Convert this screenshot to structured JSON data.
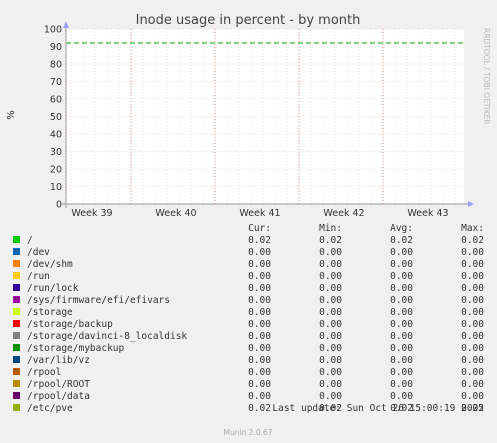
{
  "chart_data": {
    "type": "line",
    "title": "Inode usage in percent - by month",
    "ylabel": "%",
    "side_label": "RRDTOOL / TOBI OETIKER",
    "ylim": [
      0,
      100
    ],
    "yticks": [
      0,
      10,
      20,
      30,
      40,
      50,
      60,
      70,
      80,
      90,
      100
    ],
    "xtick_labels": [
      "Week 39",
      "Week 40",
      "Week 41",
      "Week 42",
      "Week 43"
    ],
    "warning_level": 92,
    "grid": true,
    "columns": [
      "Cur:",
      "Min:",
      "Avg:",
      "Max:"
    ],
    "series": [
      {
        "name": "/",
        "color": "#00cc00",
        "cur": "0.02",
        "min": "0.02",
        "avg": "0.02",
        "max": "0.02"
      },
      {
        "name": "/dev",
        "color": "#0066b3",
        "cur": "0.00",
        "min": "0.00",
        "avg": "0.00",
        "max": "0.00"
      },
      {
        "name": "/dev/shm",
        "color": "#ff8000",
        "cur": "0.00",
        "min": "0.00",
        "avg": "0.00",
        "max": "0.00"
      },
      {
        "name": "/run",
        "color": "#ffcc00",
        "cur": "0.00",
        "min": "0.00",
        "avg": "0.00",
        "max": "0.00"
      },
      {
        "name": "/run/lock",
        "color": "#330099",
        "cur": "0.00",
        "min": "0.00",
        "avg": "0.00",
        "max": "0.00"
      },
      {
        "name": "/sys/firmware/efi/efivars",
        "color": "#990099",
        "cur": "0.00",
        "min": "0.00",
        "avg": "0.00",
        "max": "0.00"
      },
      {
        "name": "/storage",
        "color": "#ccff00",
        "cur": "0.00",
        "min": "0.00",
        "avg": "0.00",
        "max": "0.00"
      },
      {
        "name": "/storage/backup",
        "color": "#ff0000",
        "cur": "0.00",
        "min": "0.00",
        "avg": "0.00",
        "max": "0.00"
      },
      {
        "name": "/storage/davinci-8_localdisk",
        "color": "#808080",
        "cur": "0.00",
        "min": "0.00",
        "avg": "0.00",
        "max": "0.00"
      },
      {
        "name": "/storage/mybackup",
        "color": "#008f00",
        "cur": "0.00",
        "min": "0.00",
        "avg": "0.00",
        "max": "0.00"
      },
      {
        "name": "/var/lib/vz",
        "color": "#00487d",
        "cur": "0.00",
        "min": "0.00",
        "avg": "0.00",
        "max": "0.00"
      },
      {
        "name": "/rpool",
        "color": "#b35a00",
        "cur": "0.00",
        "min": "0.00",
        "avg": "0.00",
        "max": "0.00"
      },
      {
        "name": "/rpool/ROOT",
        "color": "#b38f00",
        "cur": "0.00",
        "min": "0.00",
        "avg": "0.00",
        "max": "0.00"
      },
      {
        "name": "/rpool/data",
        "color": "#6b006b",
        "cur": "0.00",
        "min": "0.00",
        "avg": "0.00",
        "max": "0.00"
      },
      {
        "name": "/etc/pve",
        "color": "#8fb300",
        "cur": "0.02",
        "min": "0.02",
        "avg": "0.02",
        "max": "0.02"
      }
    ],
    "last_update": "Last update: Sun Oct 26 15:00:19 2025",
    "footer": "Munin 2.0.67",
    "colors": {
      "background": "#f0f0f0",
      "plot_background": "#ffffff",
      "minor_grid": "#e6b4b4",
      "major_grid": "#e05050",
      "warning_line": "#00aa00",
      "axis": "#999999",
      "text": "#333333"
    }
  }
}
